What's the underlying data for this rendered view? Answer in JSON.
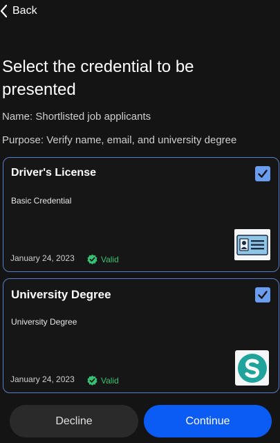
{
  "header": {
    "back_label": "Back"
  },
  "title": "Select the credential to be presented",
  "request": {
    "name_line": "Name: Shortlisted job applicants",
    "purpose_line": "Purpose: Verify name, email, and university degree"
  },
  "credentials": [
    {
      "title": "Driver's License",
      "type": "Basic Credential",
      "date": "January 24, 2023",
      "status": "Valid",
      "selected": true,
      "image_icon": "id-card-icon"
    },
    {
      "title": "University Degree",
      "type": "University Degree",
      "date": "January 24, 2023",
      "status": "Valid",
      "selected": true,
      "image_icon": "university-s-logo-icon"
    }
  ],
  "actions": {
    "decline_label": "Decline",
    "continue_label": "Continue"
  },
  "colors": {
    "background": "#141414",
    "card_border": "#5a7ec8",
    "checkbox": "#6a9df0",
    "valid": "#38c172",
    "primary": "#0a5cf5",
    "secondary": "#2a2a2a",
    "logo_teal": "#1fa39a"
  }
}
